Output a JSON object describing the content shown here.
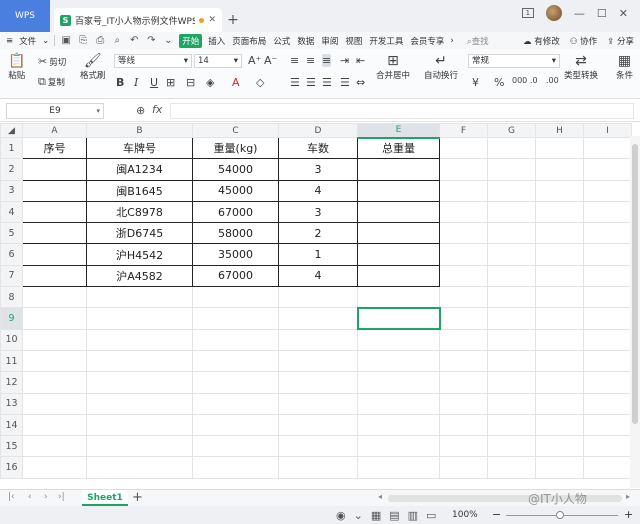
{
  "titlebar": {
    "app_tab": "WPS",
    "file_tab": "百家号_IT小人物示例文件WPS.xlsx",
    "file_icon_letter": "S",
    "badge": "1"
  },
  "menubar": {
    "file_menu": "文件",
    "items": [
      "开始",
      "插入",
      "页面布局",
      "公式",
      "数据",
      "审阅",
      "视图",
      "开发工具",
      "会员专享"
    ],
    "search": "查找",
    "right": [
      "有修改",
      "协作",
      "分享"
    ]
  },
  "ribbon": {
    "paste": "粘贴",
    "cut": "剪切",
    "copy": "复制",
    "format_painter": "格式刷",
    "font_name": "等线",
    "font_size": "14",
    "merge_center": "合并居中",
    "wrap_text": "自动换行",
    "number_format": "常规",
    "type_convert": "类型转换",
    "more": "条件"
  },
  "formula_bar": {
    "name_box": "E9",
    "fx": "fx",
    "value": ""
  },
  "sheet": {
    "columns": [
      "A",
      "B",
      "C",
      "D",
      "E",
      "F",
      "G",
      "H",
      "I"
    ],
    "selected_col": "E",
    "selected_row": "9",
    "header_row": [
      "序号",
      "车牌号",
      "重量(kg)",
      "车数",
      "总重量"
    ],
    "rows": [
      {
        "num": "2",
        "cells": [
          "",
          "闽A1234",
          "54000",
          "3",
          ""
        ]
      },
      {
        "num": "3",
        "cells": [
          "",
          "闽B1645",
          "45000",
          "4",
          ""
        ]
      },
      {
        "num": "4",
        "cells": [
          "",
          "北C8978",
          "67000",
          "3",
          ""
        ]
      },
      {
        "num": "5",
        "cells": [
          "",
          "浙D6745",
          "58000",
          "2",
          ""
        ]
      },
      {
        "num": "6",
        "cells": [
          "",
          "沪H4542",
          "35000",
          "1",
          ""
        ]
      },
      {
        "num": "7",
        "cells": [
          "",
          "沪A4582",
          "67000",
          "4",
          ""
        ]
      }
    ],
    "empty_rows": [
      "8",
      "9",
      "10",
      "11",
      "12",
      "13",
      "14",
      "15",
      "16"
    ]
  },
  "sheet_tabs": {
    "active": "Sheet1"
  },
  "statusbar": {
    "zoom": "100%"
  },
  "watermark": "@IT小人物"
}
